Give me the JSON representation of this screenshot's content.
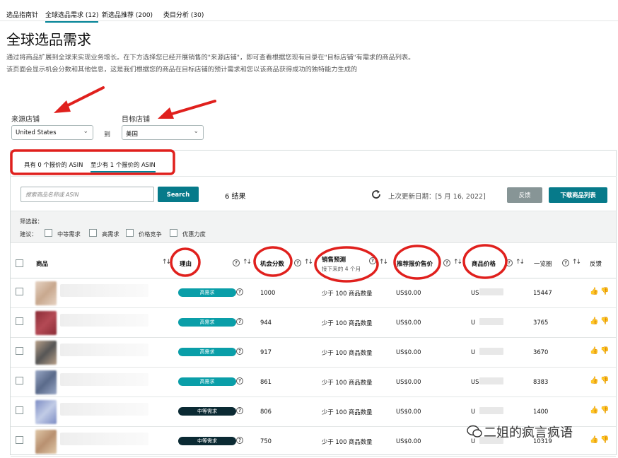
{
  "tabs": [
    {
      "label": "选品指南针",
      "active": false
    },
    {
      "label": "全球选品需求 (12)",
      "active": true
    },
    {
      "label": "新选品推荐 (200)",
      "active": false
    },
    {
      "label": "类目分析 (30)",
      "active": false
    }
  ],
  "page": {
    "title": "全球选品需求",
    "description": "通过将商品扩展到全球来实现业务增长。在下方选择您已经开展销售的\"来源店铺\"，即可查看根据您现有目录在\"目标店铺\"有需求的商品列表。该页面会显示机会分数和其他信息，这是我们根据您的商品在目标店铺的预计需求和您以该商品获得成功的独特能力生成的"
  },
  "stores": {
    "source_label": "来源店铺",
    "source_value": "United States",
    "to_label": "到",
    "target_label": "目标店铺",
    "target_value": "美国"
  },
  "offer_tabs": [
    {
      "label": "具有 0 个报价的 ASIN",
      "active": false
    },
    {
      "label": "至少有 1 个报价的 ASIN",
      "active": true
    }
  ],
  "toolbar": {
    "search_placeholder": "搜索商品名称或 ASIN",
    "search_button": "Search",
    "results": "6 结果",
    "last_updated": "上次更新日期：[5 月 16, 2022]",
    "feedback_button": "反馈",
    "download_button": "下载商品列表"
  },
  "filters": {
    "title": "筛选器：",
    "suggest_label": "建议：",
    "options": [
      "中等需求",
      "高需求",
      "价格竞争",
      "优惠力度"
    ]
  },
  "table": {
    "headers": {
      "product": "商品",
      "reason": "理由",
      "opportunity_score": "机会分数",
      "sales_forecast": "销售预测",
      "sales_forecast_sub": "接下来的 4 个月",
      "recommended_price": "推荐报价售价",
      "product_price": "商品价格",
      "bsr": "一览圈",
      "feedback": "反馈"
    },
    "rows": [
      {
        "reason": "高需求",
        "reason_level": "high",
        "score": "1000",
        "forecast": "少于 100 商品数量",
        "rec_price": "US$0.00",
        "price_prefix": "US",
        "bsr": "15447"
      },
      {
        "reason": "高需求",
        "reason_level": "high",
        "score": "944",
        "forecast": "少于 100 商品数量",
        "rec_price": "US$0.00",
        "price_prefix": "U",
        "bsr": "3765"
      },
      {
        "reason": "高需求",
        "reason_level": "high",
        "score": "917",
        "forecast": "少于 100 商品数量",
        "rec_price": "US$0.00",
        "price_prefix": "U",
        "bsr": "3670"
      },
      {
        "reason": "高需求",
        "reason_level": "high",
        "score": "861",
        "forecast": "少于 100 商品数量",
        "rec_price": "US$0.00",
        "price_prefix": "US",
        "bsr": "8383"
      },
      {
        "reason": "中等需求",
        "reason_level": "medium",
        "score": "806",
        "forecast": "少于 100 商品数量",
        "rec_price": "US$0.00",
        "price_prefix": "U",
        "bsr": "1400"
      },
      {
        "reason": "中等需求",
        "reason_level": "medium",
        "score": "750",
        "forecast": "少于 100 商品数量",
        "rec_price": "US$0.00",
        "price_prefix": "U",
        "bsr": "10319"
      }
    ]
  },
  "watermark": "二姐的疯言疯语",
  "colors": {
    "accent": "#067a8a",
    "high_demand": "#0a9ea8",
    "medium_demand": "#0b2a33",
    "annotation_red": "#e0201d",
    "disabled_button": "#879596"
  }
}
